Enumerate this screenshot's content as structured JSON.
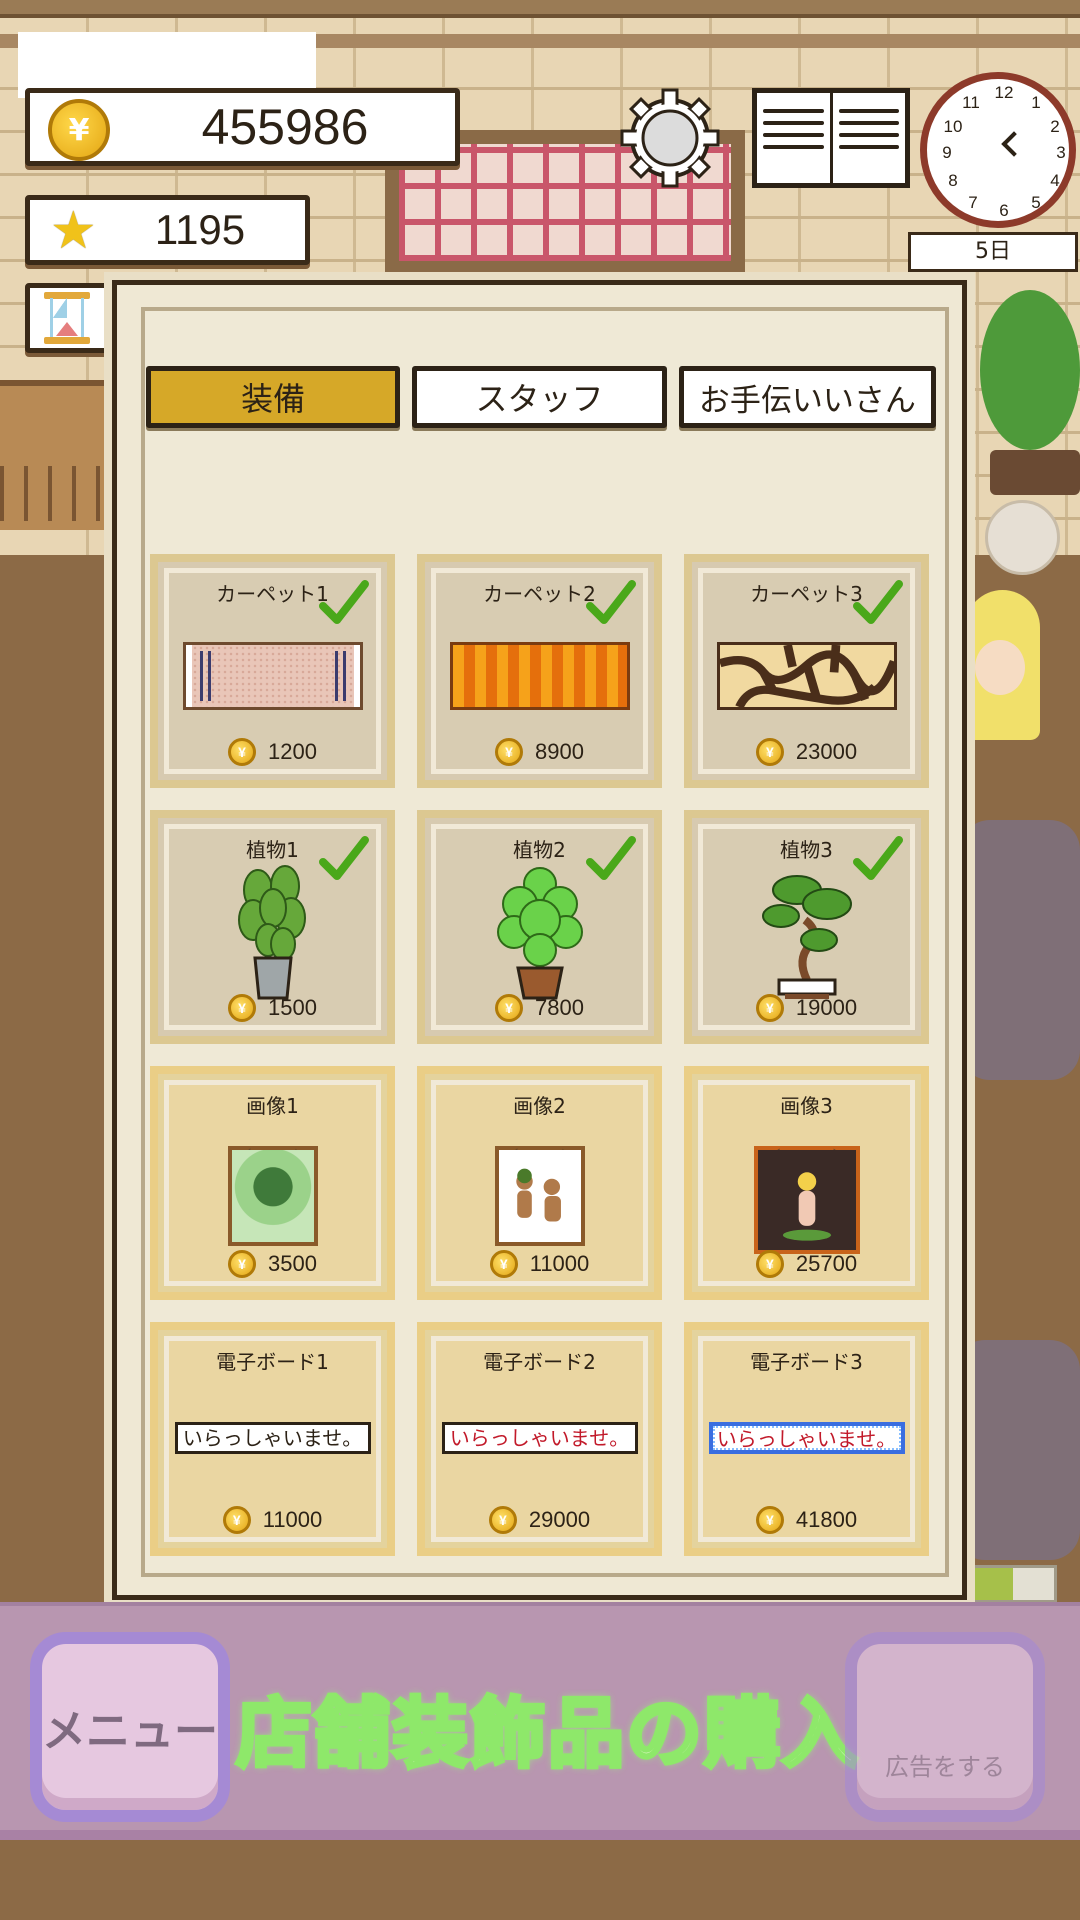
{
  "hud": {
    "money": "455986",
    "stars": "1195",
    "day": "5日",
    "coin_symbol": "¥",
    "clock_numbers": [
      "12",
      "1",
      "2",
      "3",
      "4",
      "5",
      "6",
      "7",
      "8",
      "9",
      "10",
      "11"
    ]
  },
  "tabs": [
    {
      "label": "装備",
      "active": true
    },
    {
      "label": "スタッフ",
      "active": false
    },
    {
      "label": "お手伝いいさん",
      "active": false
    }
  ],
  "items": [
    {
      "name": "カーペット1",
      "price": "1200",
      "owned": true,
      "icon": "carpet-plain-icon"
    },
    {
      "name": "カーペット2",
      "price": "8900",
      "owned": true,
      "icon": "carpet-striped-icon"
    },
    {
      "name": "カーペット3",
      "price": "23000",
      "owned": true,
      "icon": "carpet-giraffe-icon"
    },
    {
      "name": "植物1",
      "price": "1500",
      "owned": true,
      "icon": "plant-pothos-icon"
    },
    {
      "name": "植物2",
      "price": "7800",
      "owned": true,
      "icon": "plant-bush-icon"
    },
    {
      "name": "植物3",
      "price": "19000",
      "owned": true,
      "icon": "plant-bonsai-icon"
    },
    {
      "name": "画像1",
      "price": "3500",
      "owned": false,
      "icon": "picture-frame-icon"
    },
    {
      "name": "画像2",
      "price": "11000",
      "owned": false,
      "icon": "picture-frame-icon"
    },
    {
      "name": "画像3",
      "price": "25700",
      "owned": false,
      "icon": "picture-frame-icon"
    },
    {
      "name": "電子ボード1",
      "price": "11000",
      "owned": false,
      "board_text": "いらっしゃいませ。"
    },
    {
      "name": "電子ボード2",
      "price": "29000",
      "owned": false,
      "board_text": "いらっしゃいませ。"
    },
    {
      "name": "電子ボード3",
      "price": "41800",
      "owned": false,
      "board_text": "いらっしゃいませ。"
    }
  ],
  "bottom": {
    "menu_label": "メニュー",
    "title": "店舗装飾品の購入",
    "ad_label": "広告をする"
  },
  "colors": {
    "active_tab": "#d6a828",
    "check": "#4aa81a",
    "panel": "#efe8d4",
    "bottom_bar": "#b896b0"
  }
}
